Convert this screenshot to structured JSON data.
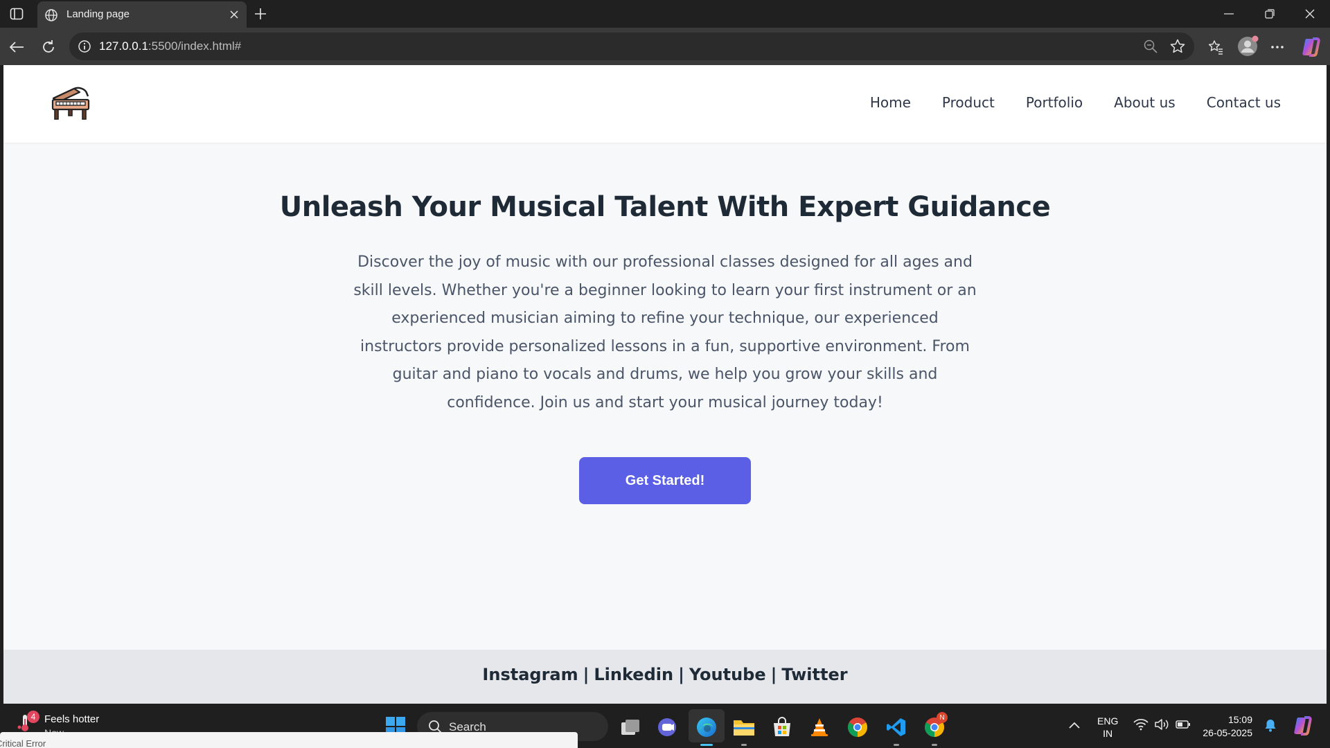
{
  "browser": {
    "tab_title": "Landing page",
    "url_host": "127.0.0.1",
    "url_rest": ":5500/index.html#"
  },
  "site": {
    "nav": [
      "Home",
      "Product",
      "Portfolio",
      "About us",
      "Contact us"
    ],
    "hero_title": "Unleash Your Musical Talent With Expert Guidance",
    "hero_text": "Discover the joy of music with our professional classes designed for all ages and skill levels. Whether you're a beginner looking to learn your first instrument or an experienced musician aiming to refine your technique, our experienced instructors provide personalized lessons in a fun, supportive environment. From guitar and piano to vocals and drums, we help you grow your skills and confidence. Join us and start your musical journey today!",
    "cta_label": "Get Started!",
    "footer_links": [
      "Instagram",
      "Linkedin",
      "Youtube",
      "Twitter"
    ],
    "footer_separator": "|"
  },
  "taskbar": {
    "weather_badge": "4",
    "weather_title": "Feels hotter",
    "weather_sub": "Now",
    "error_toast": "Critical Error",
    "search_label": "Search",
    "lang_line1": "ENG",
    "lang_line2": "IN",
    "time": "15:09",
    "date": "26-05-2025",
    "chrome_badge": "N"
  },
  "colors": {
    "accent": "#5a5fe6",
    "page_bg": "#f7f8fa",
    "footer_bg": "#e5e7eb",
    "heading": "#1f2a37"
  }
}
